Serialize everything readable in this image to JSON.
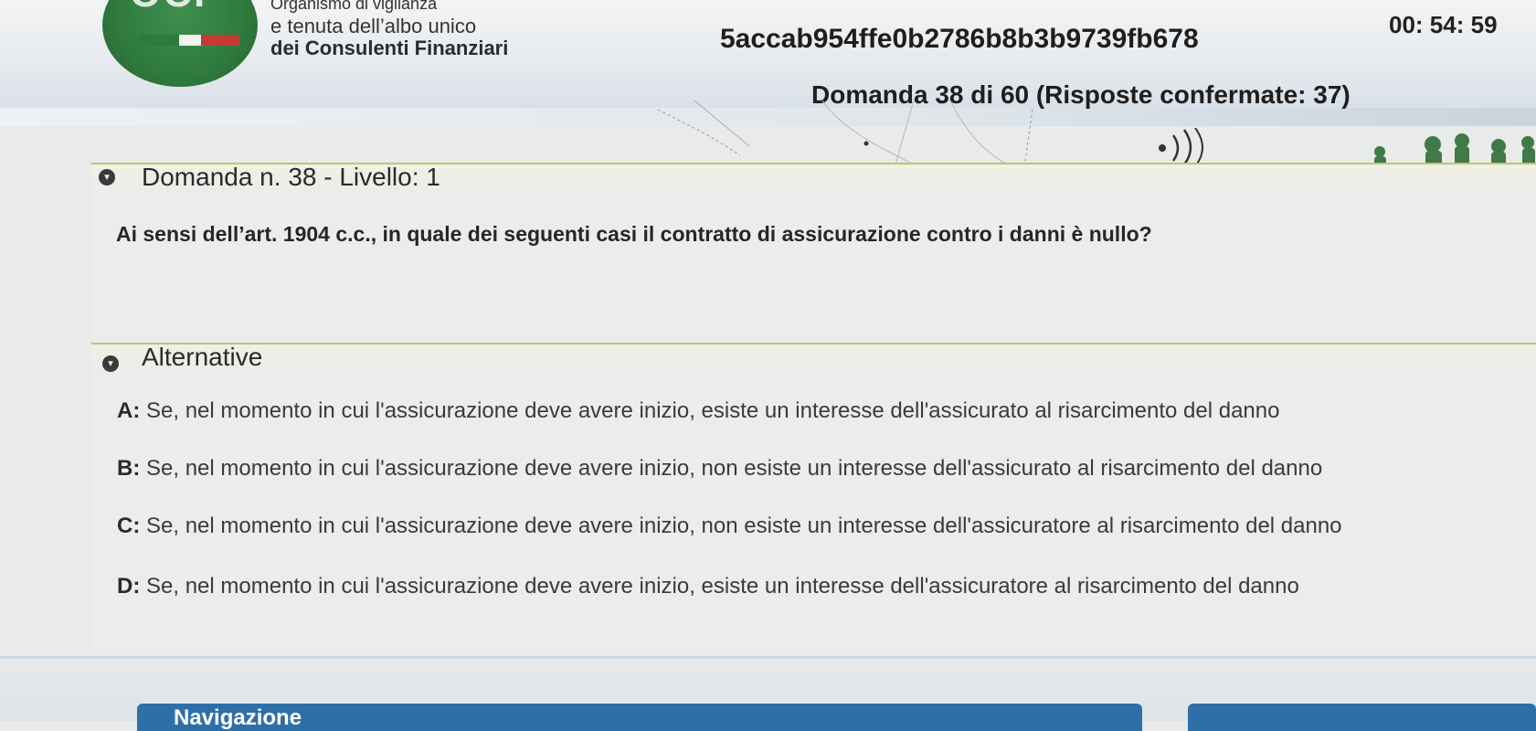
{
  "header": {
    "logo_text": "OCF",
    "org_line_1": "Organismo di vigilanza",
    "org_line_2": "e tenuta dell’albo unico",
    "org_line_3": "dei Consulenti Finanziari",
    "session_id": "5accab954ffe0b2786b8b3b9739fb678",
    "timer": "00: 54: 59",
    "progress": "Domanda 38 di 60 (Risposte confermate: 37)",
    "audio_icon": "speaker-icon"
  },
  "question_panel": {
    "title": "Domanda n. 38 - Livello: 1",
    "text": "Ai sensi dell’art. 1904 c.c., in quale dei seguenti casi il contratto di assicurazione contro i danni è nullo?"
  },
  "answers_panel": {
    "title": "Alternative",
    "options": [
      {
        "key": "A:",
        "text": "Se, nel momento in cui l'assicurazione deve avere inizio, esiste un interesse dell'assicurato al risarcimento del danno"
      },
      {
        "key": "B:",
        "text": "Se, nel momento in cui l'assicurazione deve avere inizio, non esiste un interesse dell'assicurato al risarcimento del danno"
      },
      {
        "key": "C:",
        "text": "Se, nel momento in cui l'assicurazione deve avere inizio, non esiste un interesse dell'assicuratore al risarcimento del danno"
      },
      {
        "key": "D:",
        "text": "Se, nel momento in cui l'assicurazione deve avere inizio, esiste un interesse dell'assicuratore al risarcimento del danno"
      }
    ]
  },
  "footer": {
    "nav_label": "Navigazione"
  },
  "colors": {
    "brand_green": "#2f7a3e",
    "accent_olive": "#b8c47a",
    "nav_blue": "#2f6fa8"
  }
}
